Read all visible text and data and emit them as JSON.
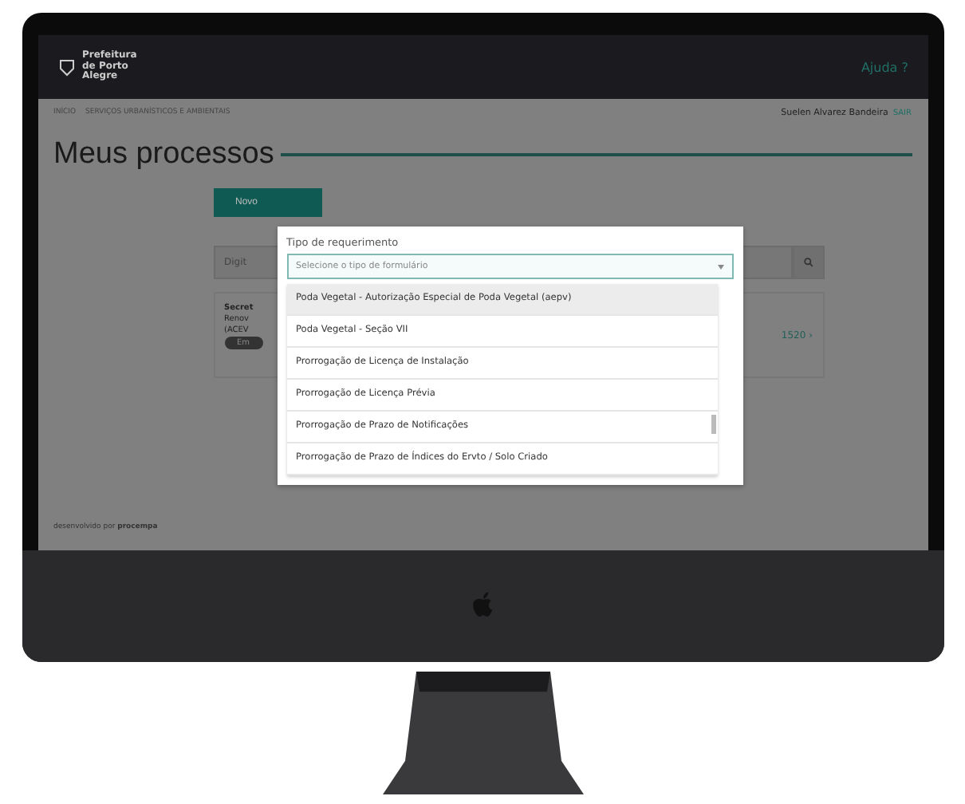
{
  "header": {
    "logo_text": "Prefeitura de Porto Alegre",
    "help": "Ajuda ?"
  },
  "breadcrumb": [
    "INÍCIO",
    "SERVIÇOS URBANÍSTICOS E AMBIENTAIS"
  ],
  "user": {
    "name": "Suelen Alvarez Bandeira",
    "logout": "SAIR"
  },
  "page_title": "Meus processos",
  "new_button": "Novo",
  "search": {
    "placeholder": "Digit"
  },
  "card": {
    "lines": [
      "Secret",
      "Renov",
      "(ACEV"
    ],
    "tag": "Em",
    "number": "1520 ›"
  },
  "footer": {
    "prefix": "desenvolvido por",
    "brand": "procempa"
  },
  "modal": {
    "label": "Tipo de requerimento",
    "placeholder": "Selecione o tipo de formulário",
    "options": [
      {
        "label": "Poda Vegetal - Autorização Especial de Poda Vegetal (aepv)",
        "selected": true
      },
      {
        "label": "Poda Vegetal - Seção VII",
        "selected": false
      },
      {
        "label": "Prorrogação de Licença de Instalação",
        "selected": false
      },
      {
        "label": "Prorrogação de Licença Prévia",
        "selected": false
      },
      {
        "label": "Prorrogação de Prazo de Notificações",
        "selected": false
      },
      {
        "label": "Prorrogação de Prazo de Índices do Ervto / Solo Criado",
        "selected": false
      }
    ]
  }
}
